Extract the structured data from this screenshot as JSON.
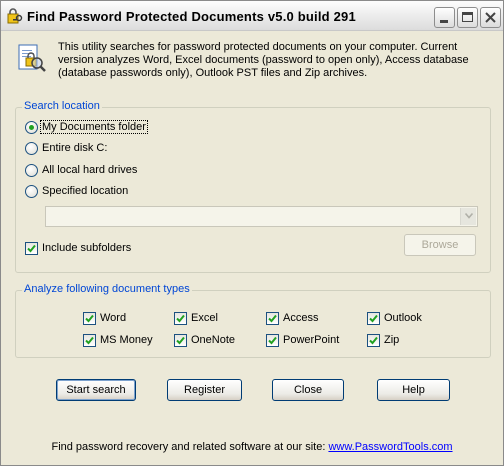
{
  "window": {
    "title": "Find Password Protected Documents v5.0 build 291"
  },
  "intro": {
    "text": "This utility searches for password protected documents on your computer. Current version analyzes Word, Excel documents (password to open only), Access database (database passwords only), Outlook PST files and Zip archives."
  },
  "search_location": {
    "title": "Search location",
    "options": [
      {
        "label": "My Documents folder",
        "selected": true
      },
      {
        "label": "Entire disk C:",
        "selected": false
      },
      {
        "label": "All local hard drives",
        "selected": false
      },
      {
        "label": "Specified location",
        "selected": false
      }
    ],
    "location_value": "",
    "include_subfolders": {
      "label": "Include subfolders",
      "checked": true
    },
    "browse_label": "Browse"
  },
  "doc_types": {
    "title": "Analyze following document types",
    "items": [
      {
        "label": "Word",
        "checked": true
      },
      {
        "label": "Excel",
        "checked": true
      },
      {
        "label": "Access",
        "checked": true
      },
      {
        "label": "Outlook",
        "checked": true
      },
      {
        "label": "MS Money",
        "checked": true
      },
      {
        "label": "OneNote",
        "checked": true
      },
      {
        "label": "PowerPoint",
        "checked": true
      },
      {
        "label": "Zip",
        "checked": true
      }
    ]
  },
  "buttons": {
    "start": "Start search",
    "register": "Register",
    "close": "Close",
    "help": "Help"
  },
  "footer": {
    "text": "Find password recovery and related software at our site: ",
    "link": "www.PasswordTools.com"
  }
}
